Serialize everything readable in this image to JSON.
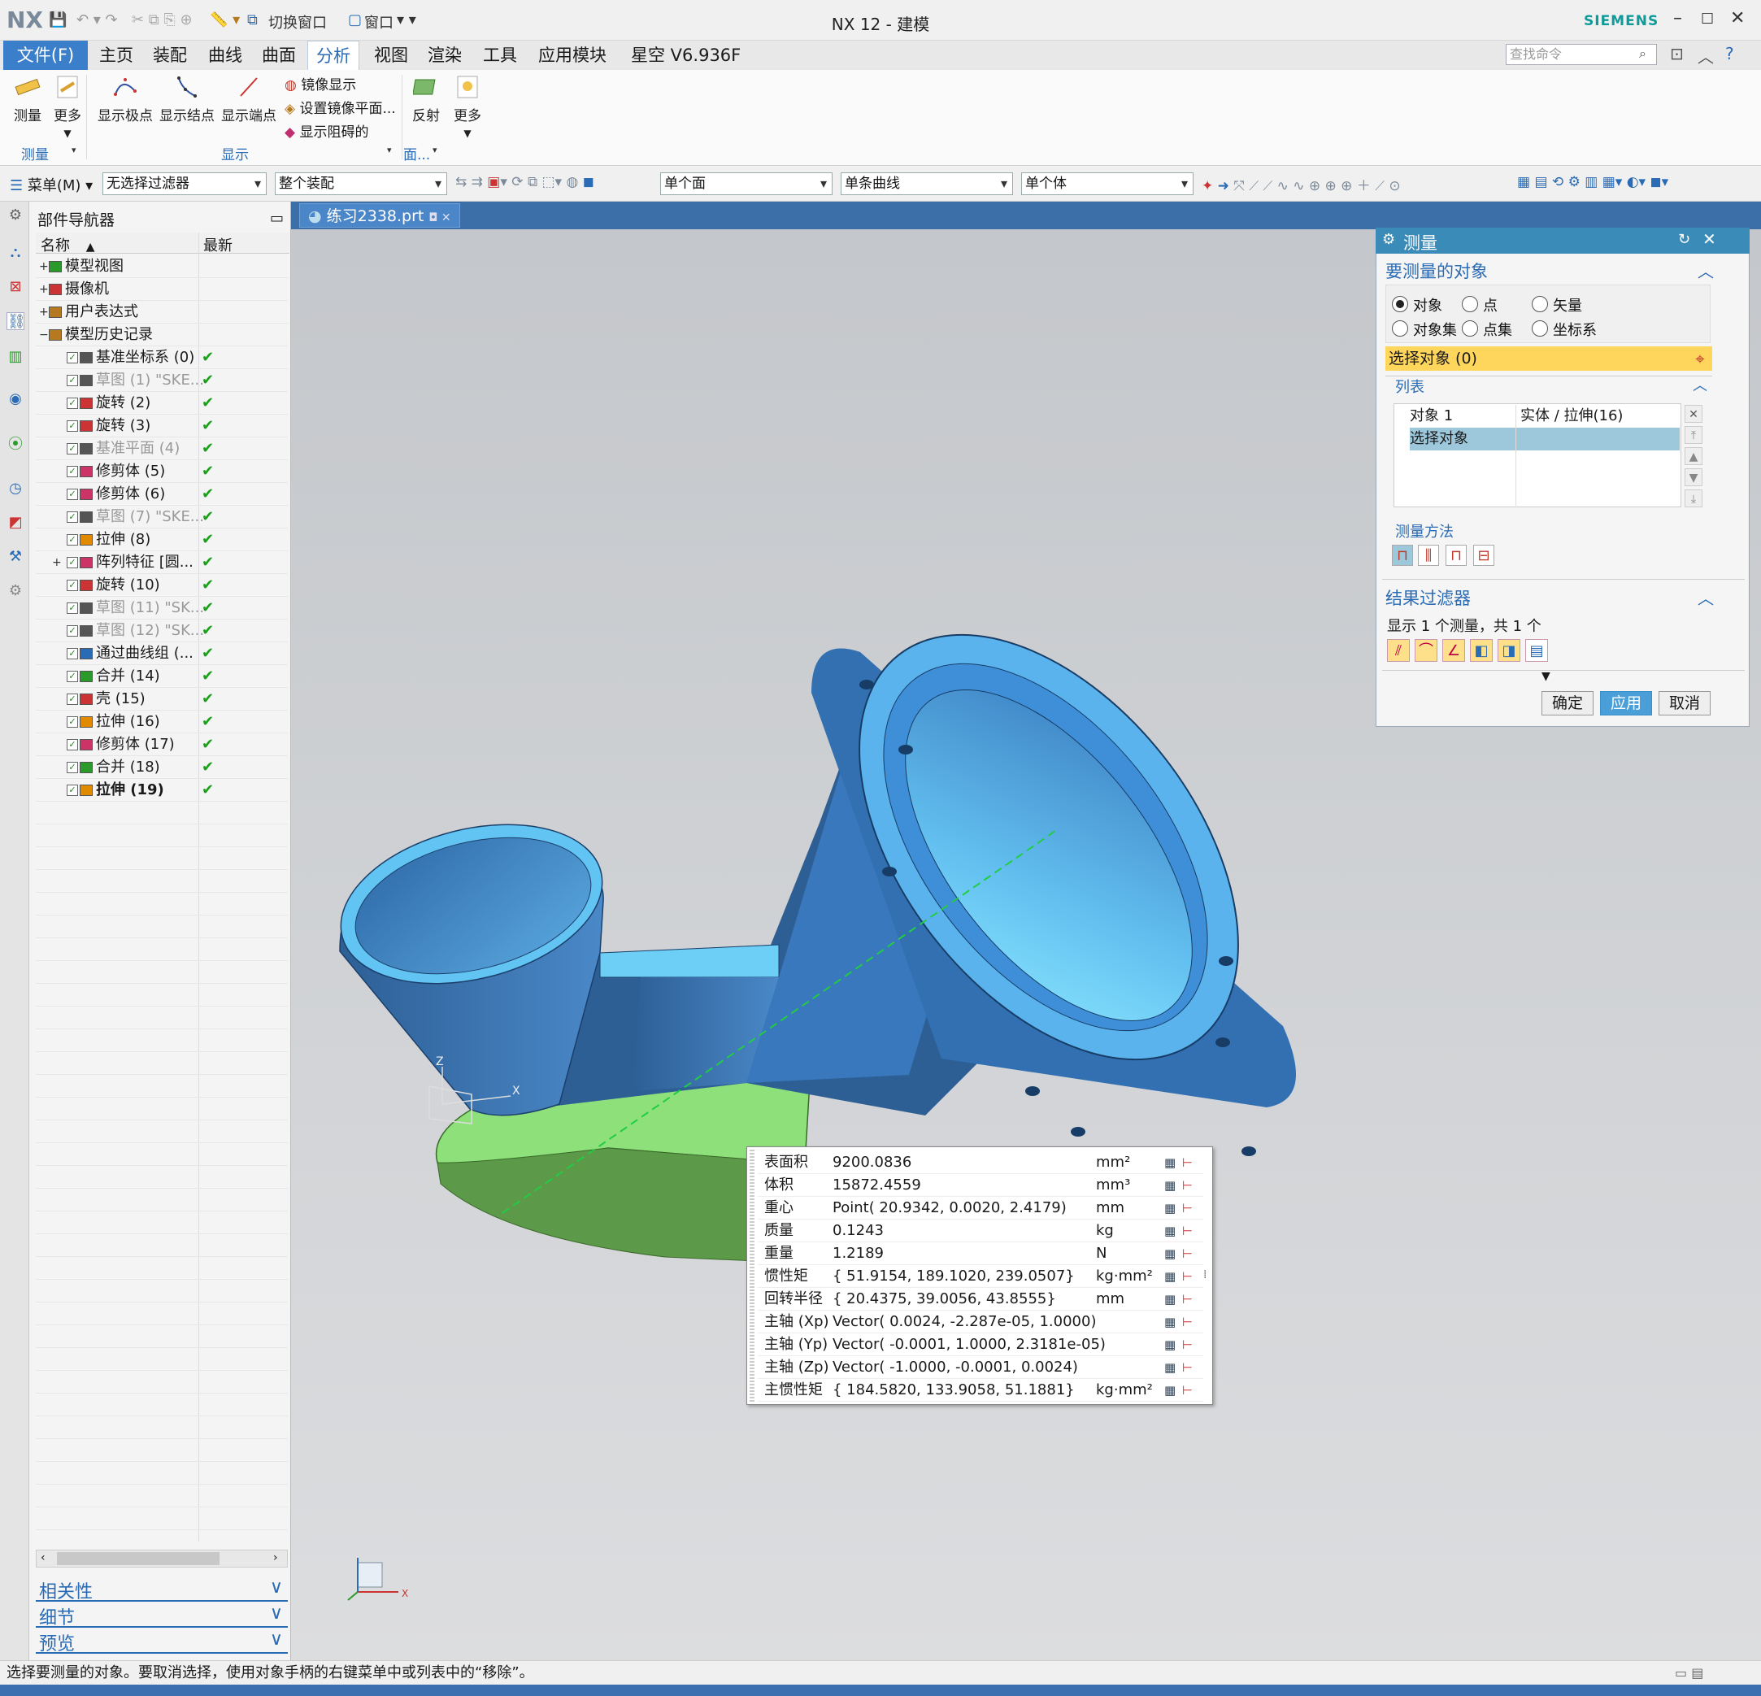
{
  "app": {
    "logo": "NX",
    "title": "NX 12 - 建模",
    "brand": "SIEMENS"
  },
  "quick_access": {
    "switch_window": "切换窗口",
    "window": "窗口"
  },
  "menu_tabs": [
    "文件(F)",
    "主页",
    "装配",
    "曲线",
    "曲面",
    "分析",
    "视图",
    "渲染",
    "工具",
    "应用模块",
    "星空 V6.936F"
  ],
  "active_tab": "分析",
  "search_placeholder": "查找命令",
  "ribbon": {
    "measure": "测量",
    "more1": "更多",
    "show_poles": "显示极点",
    "show_knots": "显示结点",
    "show_endpoints": "显示端点",
    "mirror_display": "镜像显示",
    "set_mirror_plane": "设置镜像平面...",
    "show_blocking": "显示阻碍的",
    "reflect": "反射",
    "more2": "更多",
    "group_measure": "测量",
    "group_display": "显示",
    "group_face": "面..."
  },
  "toolbar": {
    "menu": "菜单(M)",
    "filter": "无选择过滤器",
    "assembly": "整个装配",
    "face": "单个面",
    "curve": "单条曲线",
    "body": "单个体"
  },
  "navigator": {
    "title": "部件导航器",
    "col_name": "名称",
    "col_latest": "最新",
    "items": [
      {
        "label": "模型视图",
        "level": 0,
        "exp": "+",
        "check": false,
        "dim": false,
        "bold": false
      },
      {
        "label": "摄像机",
        "level": 0,
        "exp": "+",
        "check": false,
        "dim": false,
        "bold": false
      },
      {
        "label": "用户表达式",
        "level": 0,
        "exp": "+",
        "check": false,
        "dim": false,
        "bold": false
      },
      {
        "label": "模型历史记录",
        "level": 0,
        "exp": "−",
        "check": false,
        "dim": false,
        "bold": false
      },
      {
        "label": "基准坐标系 (0)",
        "level": 1,
        "exp": "",
        "check": true,
        "dim": false,
        "bold": false
      },
      {
        "label": "草图 (1) \"SKE...",
        "level": 1,
        "exp": "",
        "check": true,
        "dim": true,
        "bold": false
      },
      {
        "label": "旋转 (2)",
        "level": 1,
        "exp": "",
        "check": true,
        "dim": false,
        "bold": false
      },
      {
        "label": "旋转 (3)",
        "level": 1,
        "exp": "",
        "check": true,
        "dim": false,
        "bold": false
      },
      {
        "label": "基准平面 (4)",
        "level": 1,
        "exp": "",
        "check": true,
        "dim": true,
        "bold": false
      },
      {
        "label": "修剪体 (5)",
        "level": 1,
        "exp": "",
        "check": true,
        "dim": false,
        "bold": false
      },
      {
        "label": "修剪体 (6)",
        "level": 1,
        "exp": "",
        "check": true,
        "dim": false,
        "bold": false
      },
      {
        "label": "草图 (7) \"SKE...",
        "level": 1,
        "exp": "",
        "check": true,
        "dim": true,
        "bold": false
      },
      {
        "label": "拉伸 (8)",
        "level": 1,
        "exp": "",
        "check": true,
        "dim": false,
        "bold": false
      },
      {
        "label": "阵列特征 [圆...",
        "level": 1,
        "exp": "+",
        "check": true,
        "dim": false,
        "bold": false
      },
      {
        "label": "旋转 (10)",
        "level": 1,
        "exp": "",
        "check": true,
        "dim": false,
        "bold": false
      },
      {
        "label": "草图 (11) \"SK...",
        "level": 1,
        "exp": "",
        "check": true,
        "dim": true,
        "bold": false
      },
      {
        "label": "草图 (12) \"SK...",
        "level": 1,
        "exp": "",
        "check": true,
        "dim": true,
        "bold": false
      },
      {
        "label": "通过曲线组 (...",
        "level": 1,
        "exp": "",
        "check": true,
        "dim": false,
        "bold": false
      },
      {
        "label": "合并 (14)",
        "level": 1,
        "exp": "",
        "check": true,
        "dim": false,
        "bold": false
      },
      {
        "label": "壳 (15)",
        "level": 1,
        "exp": "",
        "check": true,
        "dim": false,
        "bold": false
      },
      {
        "label": "拉伸 (16)",
        "level": 1,
        "exp": "",
        "check": true,
        "dim": false,
        "bold": false
      },
      {
        "label": "修剪体 (17)",
        "level": 1,
        "exp": "",
        "check": true,
        "dim": false,
        "bold": false
      },
      {
        "label": "合并 (18)",
        "level": 1,
        "exp": "",
        "check": true,
        "dim": false,
        "bold": false
      },
      {
        "label": "拉伸 (19)",
        "level": 1,
        "exp": "",
        "check": true,
        "dim": false,
        "bold": true
      }
    ],
    "accordion": [
      "相关性",
      "细节",
      "预览"
    ]
  },
  "doc_tab": "练习2338.prt",
  "measure_panel": {
    "title": "测量",
    "section_objects": "要测量的对象",
    "radios": [
      {
        "label": "对象",
        "on": true
      },
      {
        "label": "点",
        "on": false
      },
      {
        "label": "矢量",
        "on": false
      },
      {
        "label": "对象集",
        "on": false
      },
      {
        "label": "点集",
        "on": false
      },
      {
        "label": "坐标系",
        "on": false
      }
    ],
    "select_object": "选择对象 (0)",
    "list_title": "列表",
    "list_row1_a": "对象 1",
    "list_row1_b": "实体 / 拉伸(16)",
    "list_row2": "选择对象",
    "method_title": "测量方法",
    "section_filter": "结果过滤器",
    "filter_info": "显示 1 个测量，共 1 个",
    "ok": "确定",
    "apply": "应用",
    "cancel": "取消"
  },
  "results": [
    {
      "label": "表面积",
      "value": "9200.0836",
      "unit": "mm²"
    },
    {
      "label": "体积",
      "value": "15872.4559",
      "unit": "mm³"
    },
    {
      "label": "重心",
      "value": "Point( 20.9342, 0.0020, 2.4179)",
      "unit": "mm"
    },
    {
      "label": "质量",
      "value": "0.1243",
      "unit": "kg"
    },
    {
      "label": "重量",
      "value": "1.2189",
      "unit": "N"
    },
    {
      "label": "惯性矩",
      "value": "{ 51.9154, 189.1020, 239.0507}",
      "unit": "kg·mm²"
    },
    {
      "label": "回转半径",
      "value": "{ 20.4375, 39.0056, 43.8555}",
      "unit": "mm"
    },
    {
      "label": "主轴 (Xp)",
      "value": "Vector( 0.0024, -2.287e-05, 1.0000)",
      "unit": ""
    },
    {
      "label": "主轴 (Yp)",
      "value": "Vector( -0.0001, 1.0000, 2.3181e-05)",
      "unit": ""
    },
    {
      "label": "主轴 (Zp)",
      "value": "Vector( -1.0000, -0.0001, 0.0024)",
      "unit": ""
    },
    {
      "label": "主惯性矩",
      "value": "{ 184.5820, 133.9058, 51.1881}",
      "unit": "kg·mm²"
    }
  ],
  "status": "选择要测量的对象。要取消选择，使用对象手柄的右键菜单中或列表中的“移除”。",
  "colors": {
    "accent": "#2a6bb5",
    "model": "#3f8fd8",
    "model_light": "#5fb8f0",
    "base": "#8de07a",
    "select": "#ffd65c"
  }
}
